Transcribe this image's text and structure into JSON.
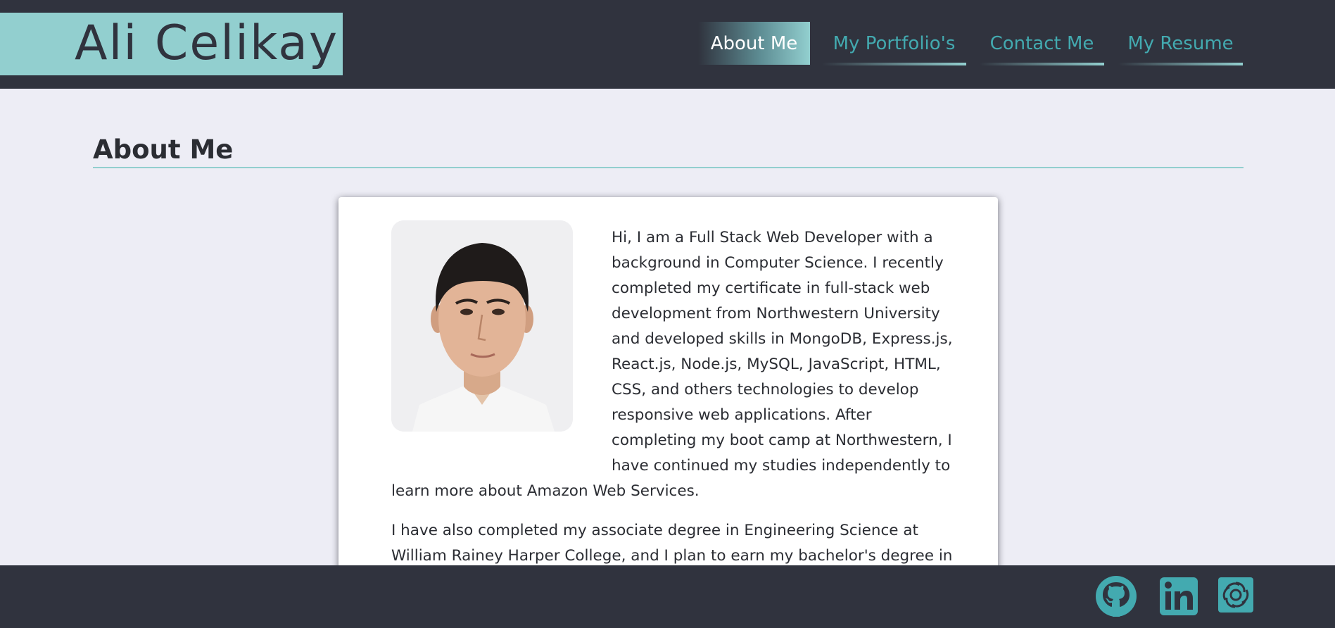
{
  "header": {
    "logo_text": "Ali Celikay",
    "nav": [
      {
        "label": "About Me",
        "active": true
      },
      {
        "label": "My Portfolio's",
        "active": false
      },
      {
        "label": "Contact Me",
        "active": false
      },
      {
        "label": "My Resume",
        "active": false
      }
    ]
  },
  "main": {
    "section_title": "About Me",
    "photo_alt": "profile-photo",
    "paragraphs": [
      "Hi, I am a Full Stack Web Developer with a background in Computer Science. I recently completed my certificate in full-stack web development from Northwestern University and developed skills in MongoDB, Express.js, React.js, Node.js, MySQL, JavaScript, HTML, CSS, and others technologies to develop responsive web applications. After completing my boot camp at Northwestern, I have continued my studies independently to learn more about Amazon Web Services.",
      "I have also completed my associate degree in Engineering Science at William Rainey Harper College, and I plan to earn my bachelor's degree in"
    ]
  },
  "footer": {
    "icons": [
      "github-icon",
      "linkedin-icon",
      "stackshare-icon"
    ]
  },
  "colors": {
    "dark": "#30333e",
    "accent": "#92cfcf",
    "link": "#43aab0",
    "background": "#ededf5"
  }
}
